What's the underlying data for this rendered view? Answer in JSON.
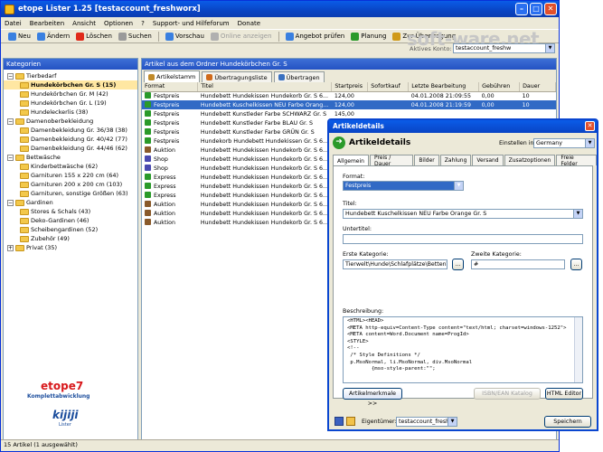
{
  "app": {
    "title": "etope Lister 1.25 [testaccount_freshworx]",
    "menu": [
      "Datei",
      "Bearbeiten",
      "Ansicht",
      "Optionen",
      "?",
      "Support- und Hilfeforum",
      "Donate"
    ],
    "toolbar": [
      {
        "label": "Neu",
        "color": "#3a80e0",
        "disabled": false
      },
      {
        "label": "Ändern",
        "color": "#3a80e0",
        "disabled": false
      },
      {
        "label": "Löschen",
        "color": "#e02a1a",
        "disabled": false
      },
      {
        "label": "Suchen",
        "color": "#9a9a9a",
        "disabled": false
      },
      {
        "label": "Vorschau",
        "color": "#3a80e0",
        "disabled": false
      },
      {
        "label": "Online anzeigen",
        "color": "#b0b0b0",
        "disabled": true
      },
      {
        "label": "Angebot prüfen",
        "color": "#3a80e0",
        "disabled": false
      },
      {
        "label": "Planung",
        "color": "#2a9a2a",
        "disabled": false
      },
      {
        "label": "Zur Übertragung",
        "color": "#d09a1a",
        "disabled": false
      }
    ],
    "account_label": "Aktives Konto:",
    "account_value": "testaccount_freshw",
    "watermark": "soft-ware.net"
  },
  "left_panel": {
    "header": "Kategorien",
    "tree": [
      {
        "level": 0,
        "label": "Tierbedarf",
        "expanded": true
      },
      {
        "level": 1,
        "label": "Hundekörbchen Gr. S (15)",
        "selected": true
      },
      {
        "level": 1,
        "label": "Hundekörbchen Gr. M (42)"
      },
      {
        "level": 1,
        "label": "Hundekörbchen Gr. L (19)"
      },
      {
        "level": 1,
        "label": "Hundeleckerlis (38)"
      },
      {
        "level": 0,
        "label": "Damenoberbekleidung",
        "expanded": true
      },
      {
        "level": 1,
        "label": "Damenbekleidung Gr. 36/38 (38)"
      },
      {
        "level": 1,
        "label": "Damenbekleidung Gr. 40/42 (77)"
      },
      {
        "level": 1,
        "label": "Damenbekleidung Gr. 44/46 (62)"
      },
      {
        "level": 0,
        "label": "Bettwäsche",
        "expanded": true
      },
      {
        "level": 1,
        "label": "Kinderbettwäsche (62)"
      },
      {
        "level": 1,
        "label": "Garnituren 155 x 220 cm (64)"
      },
      {
        "level": 1,
        "label": "Garnituren 200 x 200 cm (103)"
      },
      {
        "level": 1,
        "label": "Garnituren, sonstige Größen (63)"
      },
      {
        "level": 0,
        "label": "Gardinen",
        "expanded": true
      },
      {
        "level": 1,
        "label": "Stores & Schals (43)"
      },
      {
        "level": 1,
        "label": "Deko-Gardinen (46)"
      },
      {
        "level": 1,
        "label": "Scheibengardinen (52)"
      },
      {
        "level": 1,
        "label": "Zubehör (49)"
      },
      {
        "level": 0,
        "label": "Privat (35)"
      }
    ],
    "logo_main": "etope7",
    "logo_sub": "Komplettabwicklung",
    "logo_kijiji": "kijiji",
    "logo_kijiji_sub": "Lister"
  },
  "right_panel": {
    "header": "Artikel aus dem Ordner Hundekörbchen Gr. S",
    "tabs": [
      {
        "label": "Artikelstamm",
        "active": true
      },
      {
        "label": "Übertragungsliste",
        "active": false
      },
      {
        "label": "Übertragen",
        "active": false
      }
    ],
    "columns": [
      "Format",
      "Titel",
      "Startpreis",
      "Sofortkauf",
      "Letzte Bearbeitung",
      "Gebühren",
      "Dauer"
    ],
    "rows": [
      {
        "format": "Festpreis",
        "title": "Hundebett Hundekissen Hundekorb Gr. S 6...",
        "start": "124,00",
        "buy": "",
        "edited": "04.01.2008 21:09:55",
        "fee": "0,00",
        "dur": "10"
      },
      {
        "format": "Festpreis",
        "title": "Hundebett Kuschelkissen NEU Farbe Orang...",
        "start": "124,00",
        "buy": "",
        "edited": "04.01.2008 21:19:59",
        "fee": "0,00",
        "dur": "10",
        "selected": true
      },
      {
        "format": "Festpreis",
        "title": "Hundebett Kunstleder Farbe SCHWARZ Gr. S",
        "start": "145,00",
        "buy": "",
        "edited": "",
        "fee": "",
        "dur": ""
      },
      {
        "format": "Festpreis",
        "title": "Hundebett Kunstleder Farbe BLAU Gr. S",
        "start": "",
        "buy": "",
        "edited": "",
        "fee": "",
        "dur": ""
      },
      {
        "format": "Festpreis",
        "title": "Hundebett Kunstleder Farbe GRÜN Gr. S",
        "start": "",
        "buy": "",
        "edited": "",
        "fee": "",
        "dur": ""
      },
      {
        "format": "Festpreis",
        "title": "Hundekorb Hundebett Hundekissen Gr. S 6...",
        "start": "",
        "buy": "",
        "edited": "",
        "fee": "",
        "dur": ""
      },
      {
        "format": "Auktion",
        "title": "Hundebett Hundekissen Hundekorb Gr. S 6...",
        "start": "",
        "buy": "",
        "edited": "",
        "fee": "",
        "dur": ""
      },
      {
        "format": "Shop",
        "title": "Hundebett Hundekissen Hundekorb Gr. S 6...",
        "start": "",
        "buy": "",
        "edited": "",
        "fee": "",
        "dur": ""
      },
      {
        "format": "Shop",
        "title": "Hundebett Hundekissen Hundekorb Gr. S 6...",
        "start": "",
        "buy": "",
        "edited": "",
        "fee": "",
        "dur": ""
      },
      {
        "format": "Express",
        "title": "Hundebett Hundekissen Hundekorb Gr. S 6...",
        "start": "",
        "buy": "",
        "edited": "",
        "fee": "",
        "dur": ""
      },
      {
        "format": "Express",
        "title": "Hundebett Hundekissen Hundekorb Gr. S 6...",
        "start": "",
        "buy": "",
        "edited": "",
        "fee": "",
        "dur": ""
      },
      {
        "format": "Express",
        "title": "Hundebett Hundekissen Hundekorb Gr. S 6...",
        "start": "",
        "buy": "",
        "edited": "",
        "fee": "",
        "dur": ""
      },
      {
        "format": "Auktion",
        "title": "Hundebett Hundekissen Hundekorb Gr. S 6...",
        "start": "",
        "buy": "",
        "edited": "",
        "fee": "",
        "dur": ""
      },
      {
        "format": "Auktion",
        "title": "Hundebett Hundekissen Hundekorb Gr. S 6...",
        "start": "",
        "buy": "",
        "edited": "",
        "fee": "",
        "dur": ""
      },
      {
        "format": "Auktion",
        "title": "Hundebett Hundekissen Hundekorb Gr. S 6...",
        "start": "",
        "buy": "",
        "edited": "",
        "fee": "",
        "dur": ""
      }
    ],
    "format_colors": {
      "Festpreis": "#2a9a2a",
      "Shop": "#4a4ab0",
      "Express": "#2a9a2a",
      "Auktion": "#8a5a2a"
    }
  },
  "status": "15 Artikel (1 ausgewählt)",
  "dialog": {
    "window_title": "Artikeldetails",
    "heading": "Artikeldetails",
    "settings_label": "Einstellen in:",
    "settings_value": "Germany",
    "tabs": [
      "Allgemein",
      "Preis / Dauer",
      "Bilder",
      "Zahlung",
      "Versand",
      "Zusatzoptionen",
      "Freie Felder"
    ],
    "format_label": "Format:",
    "format_value": "Festpreis",
    "title_label": "Titel:",
    "title_value": "Hundebett Kuschelkissen NEU Farbe Orange Gr. S",
    "subtitle_label": "Untertitel:",
    "subtitle_value": "",
    "category1_label": "Erste Kategorie:",
    "category1_value": "Tierwelt\\Hunde\\Schlafplätze\\Betten\\Betti",
    "category2_label": "Zweite Kategorie:",
    "category2_value": "#",
    "browse": "...",
    "description_label": "Beschreibung:",
    "description_lines": [
      "<HTML><HEAD>",
      "<META http-equiv=Content-Type content=\"text/html; charset=windows-1252\">",
      "<META content=Word.Document name=ProgId>",
      "<STYLE>",
      "<!--",
      " /* Style Definitions */",
      " p.MsoNormal, li.MsoNormal, div.MsoNormal",
      "        {mso-style-parent:\"\";"
    ],
    "features_button": "Artikelmerkmale >>",
    "isbn_button": "ISBN/EAN Katalog",
    "html_button": "HTML Editor",
    "owner_label": "Eigentümer:",
    "owner_value": "testaccount_freshw",
    "save_button": "Speichern"
  }
}
